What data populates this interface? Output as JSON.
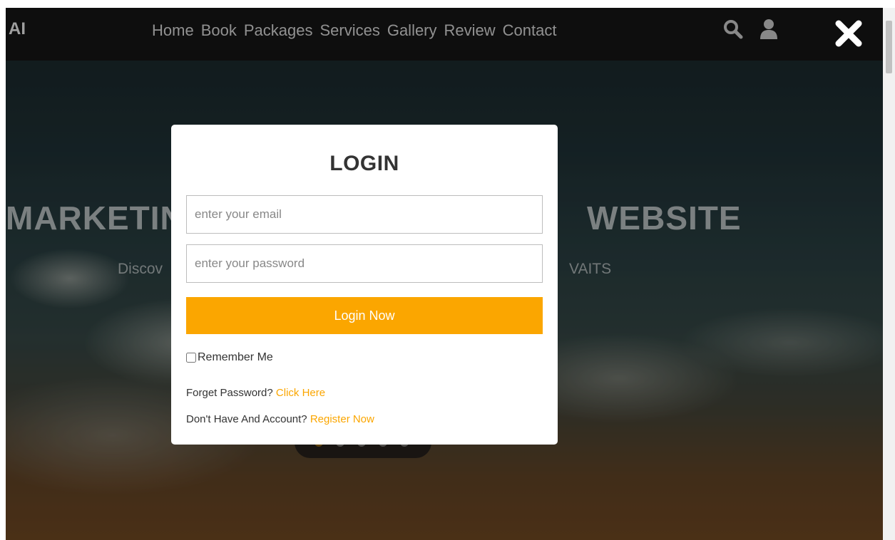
{
  "header": {
    "logo": "AI",
    "nav": [
      "Home",
      "Book",
      "Packages",
      "Services",
      "Gallery",
      "Review",
      "Contact"
    ],
    "icons": [
      "search-icon",
      "user-icon"
    ]
  },
  "hero": {
    "title_left": "MARKETIN",
    "title_right": "WEBSITE",
    "subtitle_left": "Discov",
    "subtitle_right": "VAITS"
  },
  "modal": {
    "title": "LOGIN",
    "email_placeholder": "enter your email",
    "password_placeholder": "enter your password",
    "login_button": "Login Now",
    "remember_label": "Remember Me",
    "remember_checked": false,
    "forget_text": "Forget Password?",
    "forget_link": "Click Here",
    "register_text": "Don't Have And Account?",
    "register_link": "Register Now"
  },
  "colors": {
    "accent": "#fba600",
    "header_bg": "#141414"
  }
}
